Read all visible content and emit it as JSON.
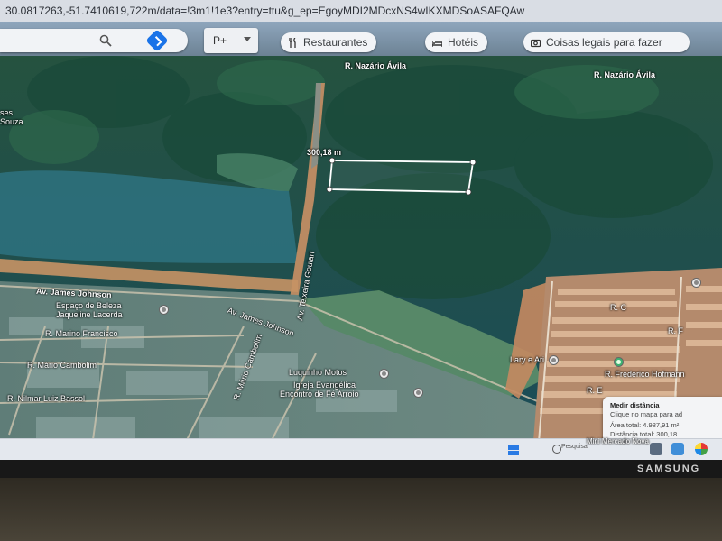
{
  "browser": {
    "url": "30.0817263,-51.7410619,722m/data=!3m1!1e3?entry=ttu&g_ep=EgoyMDI2MDcxNS4wIKXMDSoASAFQAw"
  },
  "toolbar": {
    "search_placeholder": "",
    "layer_button_label": "P+",
    "chips": [
      {
        "label": "Restaurantes",
        "icon": "fork-knife-icon"
      },
      {
        "label": "Hotéis",
        "icon": "bed-icon"
      },
      {
        "label": "Coisas legais para fazer",
        "icon": "camera-icon"
      }
    ]
  },
  "map": {
    "labels": {
      "road_nazario_1": "R. Nazário Ávila",
      "road_nazario_2": "R. Nazário Ávila",
      "souza": "Souza",
      "ses": "ses",
      "av_james_johnson": "Av. James Johnson",
      "av_james_johnson_2": "Av. James Johnson",
      "espaco_beleza": "Espaço de Beleza",
      "jaqueline": "Jaqueline Lacerda",
      "r_marino": "R. Marino Francisco",
      "r_mario_cambolim": "R. Mário Cambolim",
      "r_cambolim_2": "R. Mário Cambolim",
      "r_nilmar": "R. Nilmar Luiz Bassol",
      "luquinho": "Luquinho Motos",
      "igreja": "Igreja Evangélica",
      "encontro": "Encontro de Fé Arroio",
      "lary": "Lary e Ari",
      "r_frederico": "R. Frederico Hofmann",
      "r_vertical": "Av. Teixeira Goulart",
      "r_e": "R. E",
      "r_c": "R. C",
      "r_f": "R. F",
      "minimercado": "Mini Mercado Nova"
    },
    "measurement": {
      "label": "300,18 m"
    },
    "info_panel": {
      "title": "Medir distância",
      "subtitle": "Clique no mapa para ad",
      "area": "Área total: 4.987,91 m²",
      "distance": "Distância total: 300,18"
    }
  },
  "taskbar": {
    "search_label": "Pesquisar"
  },
  "monitor": {
    "brand": "SAMSUNG"
  },
  "colors": {
    "accent": "#1a73e8",
    "forest": "#1f5a45",
    "dirt": "#c98a55"
  }
}
